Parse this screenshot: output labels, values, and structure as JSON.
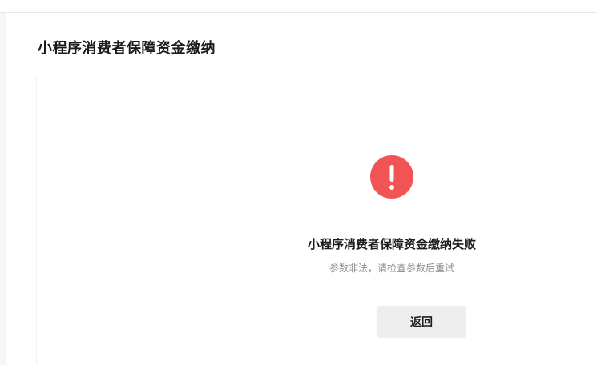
{
  "page": {
    "title": "小程序消费者保障资金缴纳"
  },
  "result": {
    "status": "error",
    "icon": "exclamation-icon",
    "icon_color": "#f05454",
    "title": "小程序消费者保障资金缴纳失败",
    "description": "参数非法，请检查参数后重试"
  },
  "actions": {
    "back_label": "返回"
  }
}
